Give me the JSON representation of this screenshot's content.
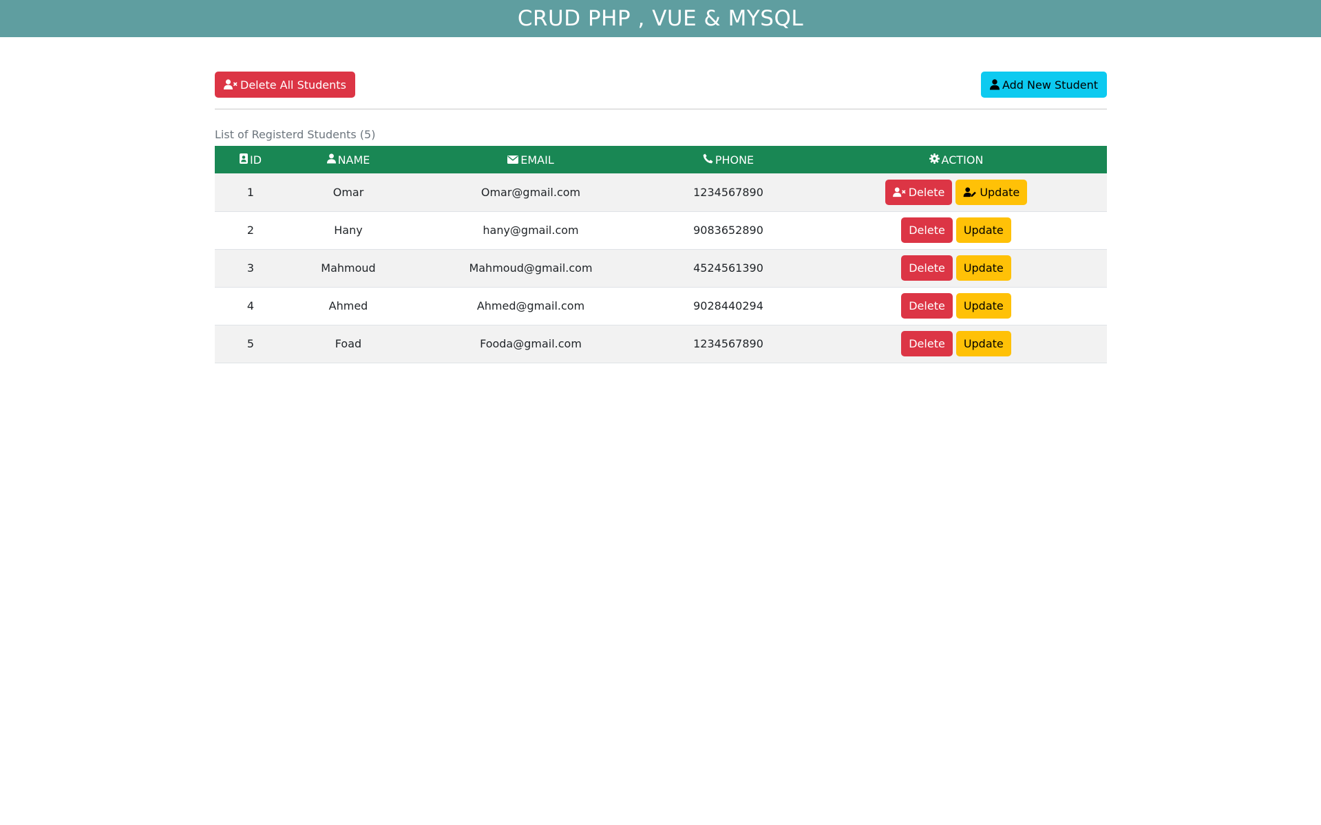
{
  "header": {
    "title": "CRUD PHP , VUE & MYSQL",
    "background": "#5f9ea0"
  },
  "toolbar": {
    "delete_all_label": "Delete All Students",
    "add_new_label": "Add New Student"
  },
  "list": {
    "caption": "List of Registerd Students (5)"
  },
  "table": {
    "header_color": "#198754",
    "columns": {
      "id": "ID",
      "name": "NAME",
      "email": "EMAIL",
      "phone": "PHONE",
      "action": "ACTION"
    },
    "rows": [
      {
        "id": "1",
        "name": "Omar",
        "email": "Omar@gmail.com",
        "phone": "1234567890",
        "delete_label": "Delete",
        "update_label": "Update"
      },
      {
        "id": "2",
        "name": "Hany",
        "email": "hany@gmail.com",
        "phone": "9083652890",
        "delete_label": "Delete",
        "update_label": "Update"
      },
      {
        "id": "3",
        "name": "Mahmoud",
        "email": "Mahmoud@gmail.com",
        "phone": "4524561390",
        "delete_label": "Delete",
        "update_label": "Update"
      },
      {
        "id": "4",
        "name": "Ahmed",
        "email": "Ahmed@gmail.com",
        "phone": "9028440294",
        "delete_label": "Delete",
        "update_label": "Update"
      },
      {
        "id": "5",
        "name": "Foad",
        "email": "Fooda@gmail.com",
        "phone": "1234567890",
        "delete_label": "Delete",
        "update_label": "Update"
      }
    ]
  },
  "icons": {
    "delete_all": "user-xmark-icon",
    "add_new": "user-icon",
    "id": "id-card-icon",
    "name": "user-icon",
    "email": "envelope-icon",
    "phone": "phone-icon",
    "action": "gear-icon",
    "row_delete": "user-xmark-icon",
    "row_update": "user-pen-icon"
  },
  "colors": {
    "danger": "#dc3545",
    "info": "#0dcaf0",
    "warning": "#ffc107"
  }
}
